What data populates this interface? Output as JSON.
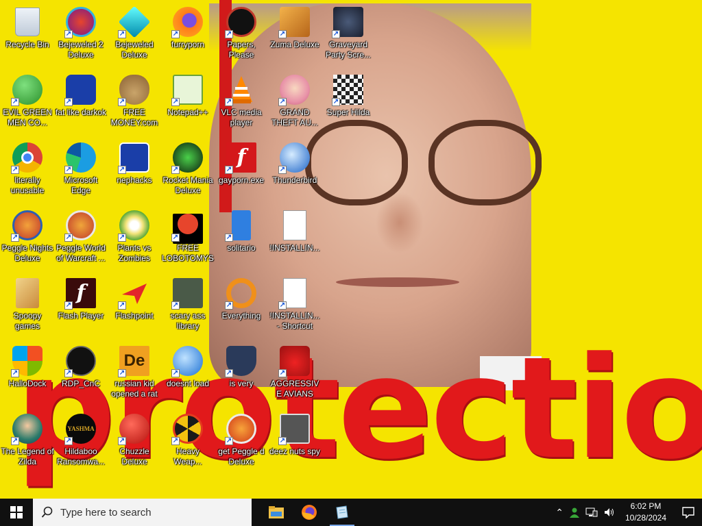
{
  "wallpaper": {
    "big_text": "protection"
  },
  "desktop_icons": [
    {
      "label": "Recycle Bin",
      "shortcut": false
    },
    {
      "label": "EVIL GREEN MEN CO...",
      "shortcut": true
    },
    {
      "label": "literally unusable",
      "shortcut": true
    },
    {
      "label": "Peggle Nights Deluxe",
      "shortcut": true
    },
    {
      "label": "Spoopy games",
      "shortcut": false
    },
    {
      "label": "HalloDock",
      "shortcut": true
    },
    {
      "label": "The Legend of Zilda",
      "shortcut": true
    },
    {
      "label": "Bejeweled 2 Deluxe",
      "shortcut": true
    },
    {
      "label": "fat like darkok",
      "shortcut": true
    },
    {
      "label": "Microsoft Edge",
      "shortcut": true
    },
    {
      "label": "Peggle World of Warcraft ...",
      "shortcut": true
    },
    {
      "label": "Flash Player",
      "shortcut": true
    },
    {
      "label": "RDP_CnC",
      "shortcut": true
    },
    {
      "label": "Hildaboo Ransomwa...",
      "shortcut": true
    },
    {
      "label": "Bejeweled Deluxe",
      "shortcut": true
    },
    {
      "label": "FREE MONEY.com",
      "shortcut": true
    },
    {
      "label": "nephacks",
      "shortcut": true
    },
    {
      "label": "Plants vs Zombies",
      "shortcut": true
    },
    {
      "label": "Flashpoint",
      "shortcut": true
    },
    {
      "label": "russian kid opened a rat",
      "shortcut": true
    },
    {
      "label": "Chuzzle Deluxe",
      "shortcut": true
    },
    {
      "label": "furryporn",
      "shortcut": true
    },
    {
      "label": "Notepad++",
      "shortcut": true
    },
    {
      "label": "Rocket Mania Deluxe",
      "shortcut": true
    },
    {
      "label": "FREE LOBOTOMYS",
      "shortcut": true
    },
    {
      "label": "scary ass library",
      "shortcut": true
    },
    {
      "label": "doesnt load",
      "shortcut": true
    },
    {
      "label": "Heavy Weap...",
      "shortcut": true
    },
    {
      "label": "Papers, Please",
      "shortcut": true
    },
    {
      "label": "VLC media player",
      "shortcut": true
    },
    {
      "label": "gayporn.exe",
      "shortcut": true
    },
    {
      "label": "solitario",
      "shortcut": true
    },
    {
      "label": "Everything",
      "shortcut": true
    },
    {
      "label": "is very",
      "shortcut": true
    },
    {
      "label": "get Peggle d Deluxe",
      "shortcut": true
    },
    {
      "label": "Zuma Deluxe",
      "shortcut": true
    },
    {
      "label": "GRAND THEFT AU...",
      "shortcut": true
    },
    {
      "label": "Thunderbird",
      "shortcut": true
    },
    {
      "label": "!INSTALLIN...",
      "shortcut": false
    },
    {
      "label": "!INSTALLIN... - Shortcut",
      "shortcut": true
    },
    {
      "label": "AGGRESSIVE AVIANS",
      "shortcut": true
    },
    {
      "label": "deez nuts spy",
      "shortcut": true
    },
    {
      "label": "Graveyard Party Scre...",
      "shortcut": true
    },
    {
      "label": "Super Hilda",
      "shortcut": true
    }
  ],
  "taskbar": {
    "search_placeholder": "Type here to search",
    "pinned": [
      {
        "icon": "file-explorer-icon"
      },
      {
        "icon": "firefox-icon"
      },
      {
        "icon": "notepad-icon",
        "active": true
      }
    ],
    "time": "6:02 PM",
    "date": "10/28/2024"
  }
}
